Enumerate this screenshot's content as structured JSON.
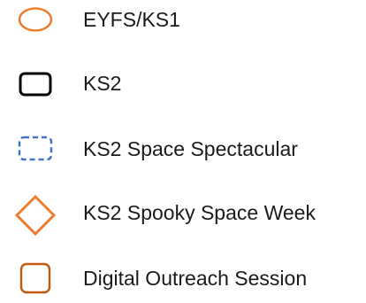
{
  "legend": {
    "items": [
      {
        "label": "EYFS/KS1",
        "symbol": "ellipse",
        "stroke": "#ed7d31",
        "style": "solid"
      },
      {
        "label": "KS2",
        "symbol": "rounded-rect",
        "stroke": "#000000",
        "style": "solid"
      },
      {
        "label": "KS2 Space Spectacular",
        "symbol": "rounded-rect",
        "stroke": "#4472c4",
        "style": "dashed"
      },
      {
        "label": "KS2 Spooky Space Week",
        "symbol": "diamond",
        "stroke": "#ed7d31",
        "style": "solid"
      },
      {
        "label": "Digital Outreach Session",
        "symbol": "rounded-rect",
        "stroke": "#c55a11",
        "style": "solid"
      }
    ]
  }
}
